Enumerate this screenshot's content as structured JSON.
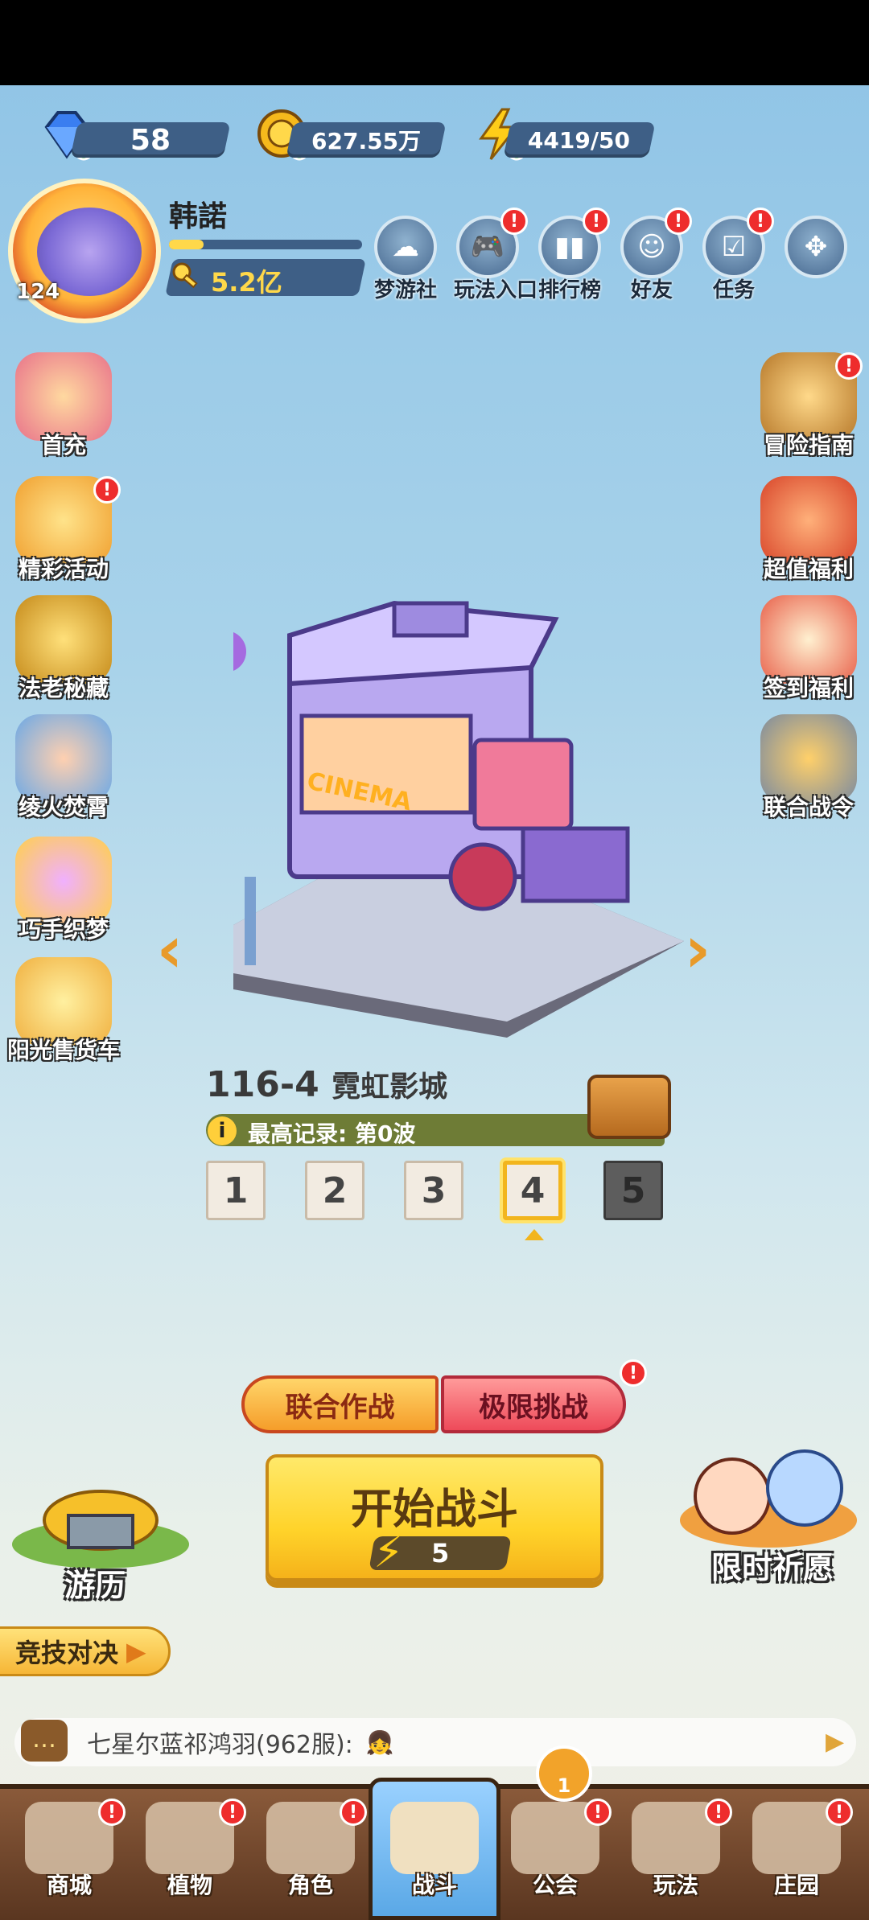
{
  "currencies": {
    "diamonds": "58",
    "coins": "627.55万",
    "stamina": "4419/50"
  },
  "player": {
    "name": "韩諾",
    "level": "124",
    "power": "5.2亿",
    "xp_progress": 0.18
  },
  "top_menu": [
    {
      "label": "梦游社",
      "badge": ""
    },
    {
      "label": "玩法入口",
      "badge": "!"
    },
    {
      "label": "排行榜",
      "badge": "!"
    },
    {
      "label": "好友",
      "badge": "!"
    },
    {
      "label": "任务",
      "badge": "!"
    }
  ],
  "left_menu": [
    {
      "label": "首充"
    },
    {
      "label": "精彩活动"
    },
    {
      "label": "法老秘藏"
    },
    {
      "label": "绫火焚霄"
    },
    {
      "label": "巧手织梦"
    },
    {
      "label": "阳光售货车"
    }
  ],
  "right_menu": [
    {
      "label": "冒险指南"
    },
    {
      "label": "超值福利"
    },
    {
      "label": "签到福利"
    },
    {
      "label": "联合战令"
    }
  ],
  "stage": {
    "number": "116-4",
    "name": "霓虹影城",
    "record": "最高记录: 第0波",
    "sign_text": "CINEMA",
    "waves": [
      "1",
      "2",
      "3",
      "4",
      "5"
    ],
    "selected_wave": 4,
    "locked_wave": 5
  },
  "modes": {
    "coop": "联合作战",
    "extreme": "极限挑战"
  },
  "start": {
    "label": "开始战斗",
    "cost": "5"
  },
  "youli_label": "游历",
  "qiyuan_label": "限时祈愿",
  "arena_label": "竞技对决",
  "chat": {
    "text": "七星尔蓝祁鸿羽(962服):"
  },
  "guild_count": "1",
  "bottom_nav": [
    {
      "label": "商城"
    },
    {
      "label": "植物"
    },
    {
      "label": "角色"
    },
    {
      "label": "战斗"
    },
    {
      "label": "公会"
    },
    {
      "label": "玩法"
    },
    {
      "label": "庄园"
    }
  ],
  "colors": {
    "accent_gold": "#ffd32a",
    "badge_red": "#ee2d2d",
    "pill_blue": "#3e5f86"
  }
}
